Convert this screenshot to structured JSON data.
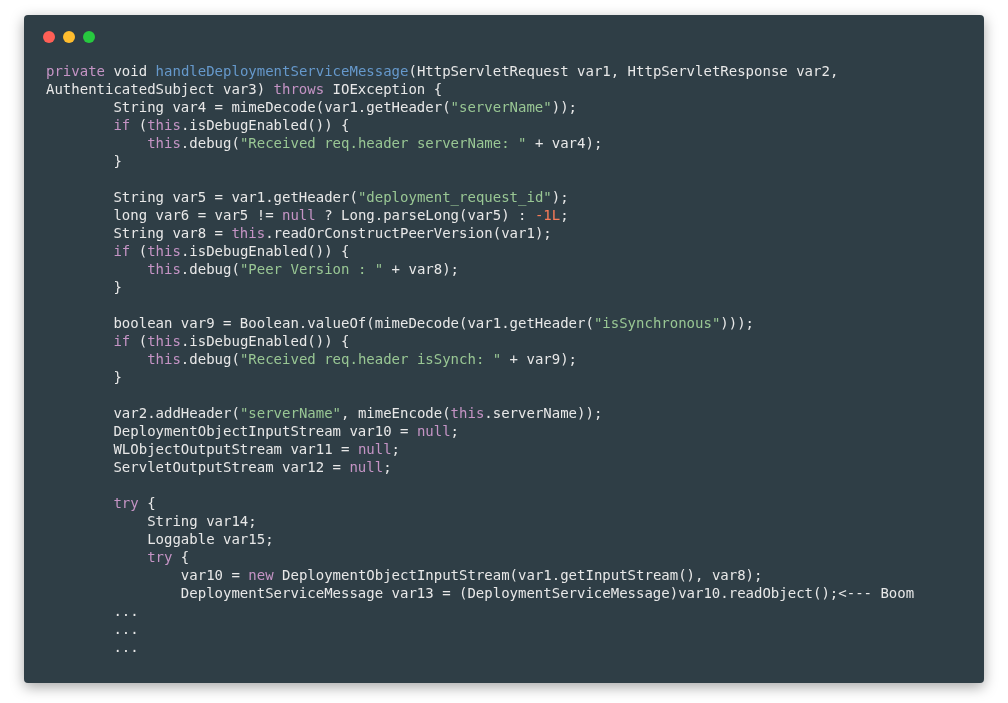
{
  "window": {
    "controls": [
      {
        "kind": "close"
      },
      {
        "kind": "minimize"
      },
      {
        "kind": "zoom"
      }
    ]
  },
  "code": {
    "lines": [
      {
        "kind": "code",
        "tokens": [
          {
            "kind": "kw",
            "text": "private"
          },
          {
            "kind": "plain",
            "text": " void "
          },
          {
            "kind": "fn",
            "text": "handleDeploymentServiceMessage"
          },
          {
            "kind": "plain",
            "text": "(HttpServletRequest var1, HttpServletResponse var2,"
          }
        ]
      },
      {
        "kind": "code",
        "tokens": [
          {
            "kind": "plain",
            "text": "AuthenticatedSubject var3) "
          },
          {
            "kind": "kw",
            "text": "throws"
          },
          {
            "kind": "plain",
            "text": " IOException {"
          }
        ]
      },
      {
        "kind": "code",
        "tokens": [
          {
            "kind": "plain",
            "text": "        String var4 = mimeDecode(var1.getHeader("
          },
          {
            "kind": "str",
            "text": "\"serverName\""
          },
          {
            "kind": "plain",
            "text": "));"
          }
        ]
      },
      {
        "kind": "code",
        "tokens": [
          {
            "kind": "kw",
            "text": "        if"
          },
          {
            "kind": "plain",
            "text": " ("
          },
          {
            "kind": "kw",
            "text": "this"
          },
          {
            "kind": "plain",
            "text": ".isDebugEnabled()) {"
          }
        ]
      },
      {
        "kind": "code",
        "tokens": [
          {
            "kind": "kw",
            "text": "            this"
          },
          {
            "kind": "plain",
            "text": ".debug("
          },
          {
            "kind": "str",
            "text": "\"Received req.header serverName: \""
          },
          {
            "kind": "plain",
            "text": " + var4);"
          }
        ]
      },
      {
        "kind": "code",
        "tokens": [
          {
            "kind": "plain",
            "text": "        }"
          }
        ]
      },
      {
        "kind": "blank"
      },
      {
        "kind": "code",
        "tokens": [
          {
            "kind": "plain",
            "text": "        String var5 = var1.getHeader("
          },
          {
            "kind": "str",
            "text": "\"deployment_request_id\""
          },
          {
            "kind": "plain",
            "text": ");"
          }
        ]
      },
      {
        "kind": "code",
        "tokens": [
          {
            "kind": "plain",
            "text": "        long var6 = var5 != "
          },
          {
            "kind": "kw",
            "text": "null"
          },
          {
            "kind": "plain",
            "text": " ? Long.parseLong(var5) : "
          },
          {
            "kind": "num",
            "text": "-1L"
          },
          {
            "kind": "plain",
            "text": ";"
          }
        ]
      },
      {
        "kind": "code",
        "tokens": [
          {
            "kind": "plain",
            "text": "        String var8 = "
          },
          {
            "kind": "kw",
            "text": "this"
          },
          {
            "kind": "plain",
            "text": ".readOrConstructPeerVersion(var1);"
          }
        ]
      },
      {
        "kind": "code",
        "tokens": [
          {
            "kind": "kw",
            "text": "        if"
          },
          {
            "kind": "plain",
            "text": " ("
          },
          {
            "kind": "kw",
            "text": "this"
          },
          {
            "kind": "plain",
            "text": ".isDebugEnabled()) {"
          }
        ]
      },
      {
        "kind": "code",
        "tokens": [
          {
            "kind": "kw",
            "text": "            this"
          },
          {
            "kind": "plain",
            "text": ".debug("
          },
          {
            "kind": "str",
            "text": "\"Peer Version : \""
          },
          {
            "kind": "plain",
            "text": " + var8);"
          }
        ]
      },
      {
        "kind": "code",
        "tokens": [
          {
            "kind": "plain",
            "text": "        }"
          }
        ]
      },
      {
        "kind": "blank"
      },
      {
        "kind": "code",
        "tokens": [
          {
            "kind": "plain",
            "text": "        boolean var9 = Boolean.valueOf(mimeDecode(var1.getHeader("
          },
          {
            "kind": "str",
            "text": "\"isSynchronous\""
          },
          {
            "kind": "plain",
            "text": ")));"
          }
        ]
      },
      {
        "kind": "code",
        "tokens": [
          {
            "kind": "kw",
            "text": "        if"
          },
          {
            "kind": "plain",
            "text": " ("
          },
          {
            "kind": "kw",
            "text": "this"
          },
          {
            "kind": "plain",
            "text": ".isDebugEnabled()) {"
          }
        ]
      },
      {
        "kind": "code",
        "tokens": [
          {
            "kind": "kw",
            "text": "            this"
          },
          {
            "kind": "plain",
            "text": ".debug("
          },
          {
            "kind": "str",
            "text": "\"Received req.header isSynch: \""
          },
          {
            "kind": "plain",
            "text": " + var9);"
          }
        ]
      },
      {
        "kind": "code",
        "tokens": [
          {
            "kind": "plain",
            "text": "        }"
          }
        ]
      },
      {
        "kind": "blank"
      },
      {
        "kind": "code",
        "tokens": [
          {
            "kind": "plain",
            "text": "        var2.addHeader("
          },
          {
            "kind": "str",
            "text": "\"serverName\""
          },
          {
            "kind": "plain",
            "text": ", mimeEncode("
          },
          {
            "kind": "kw",
            "text": "this"
          },
          {
            "kind": "plain",
            "text": ".serverName));"
          }
        ]
      },
      {
        "kind": "code",
        "tokens": [
          {
            "kind": "plain",
            "text": "        DeploymentObjectInputStream var10 = "
          },
          {
            "kind": "kw",
            "text": "null"
          },
          {
            "kind": "plain",
            "text": ";"
          }
        ]
      },
      {
        "kind": "code",
        "tokens": [
          {
            "kind": "plain",
            "text": "        WLObjectOutputStream var11 = "
          },
          {
            "kind": "kw",
            "text": "null"
          },
          {
            "kind": "plain",
            "text": ";"
          }
        ]
      },
      {
        "kind": "code",
        "tokens": [
          {
            "kind": "plain",
            "text": "        ServletOutputStream var12 = "
          },
          {
            "kind": "kw",
            "text": "null"
          },
          {
            "kind": "plain",
            "text": ";"
          }
        ]
      },
      {
        "kind": "blank"
      },
      {
        "kind": "code",
        "tokens": [
          {
            "kind": "kw",
            "text": "        try"
          },
          {
            "kind": "plain",
            "text": " {"
          }
        ]
      },
      {
        "kind": "code",
        "tokens": [
          {
            "kind": "plain",
            "text": "            String var14;"
          }
        ]
      },
      {
        "kind": "code",
        "tokens": [
          {
            "kind": "plain",
            "text": "            Loggable var15;"
          }
        ]
      },
      {
        "kind": "code",
        "tokens": [
          {
            "kind": "kw",
            "text": "            try"
          },
          {
            "kind": "plain",
            "text": " {"
          }
        ]
      },
      {
        "kind": "code",
        "tokens": [
          {
            "kind": "plain",
            "text": "                var10 = "
          },
          {
            "kind": "kw",
            "text": "new"
          },
          {
            "kind": "plain",
            "text": " DeploymentObjectInputStream(var1.getInputStream(), var8);"
          }
        ]
      },
      {
        "kind": "code",
        "tokens": [
          {
            "kind": "plain",
            "text": "                DeploymentServiceMessage var13 = (DeploymentServiceMessage)var10.readObject();<--- Boom"
          }
        ]
      },
      {
        "kind": "code",
        "tokens": [
          {
            "kind": "plain",
            "text": "        ..."
          }
        ]
      },
      {
        "kind": "code",
        "tokens": [
          {
            "kind": "plain",
            "text": "        ..."
          }
        ]
      },
      {
        "kind": "code",
        "tokens": [
          {
            "kind": "plain",
            "text": "        ..."
          }
        ]
      }
    ]
  }
}
